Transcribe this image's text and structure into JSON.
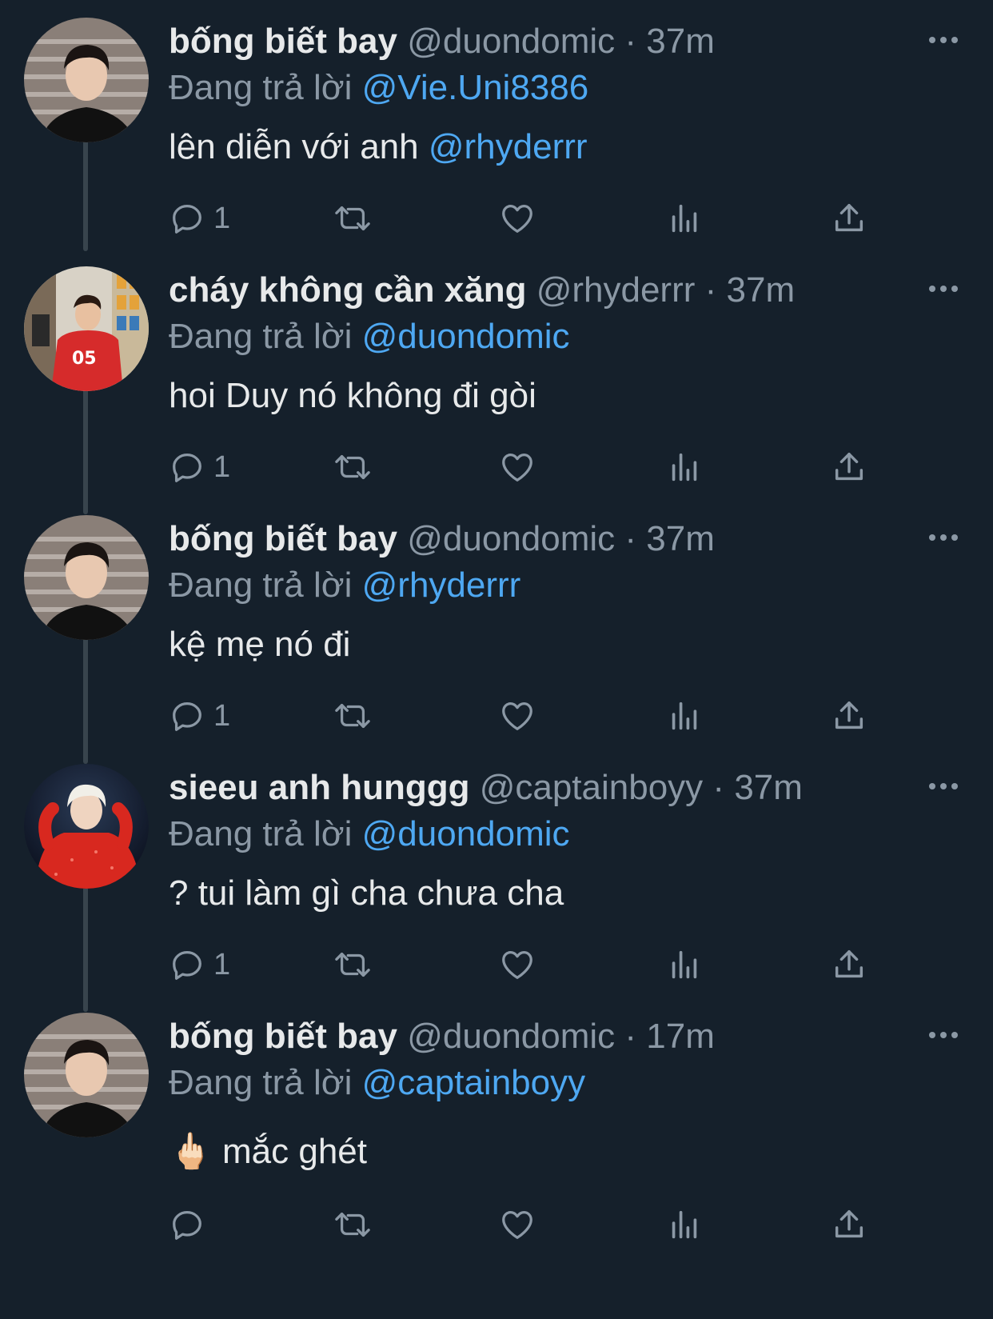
{
  "thread": {
    "reply_prefix": "Đang trả lời",
    "more_icon": "more-horizontal-icon",
    "colors": {
      "background": "#15202b",
      "name": "#e7e9ea",
      "muted": "#8b98a5",
      "mention": "#4ea8f2",
      "thread_line": "#38444d"
    },
    "tweets": [
      {
        "name": "bống biết bay",
        "handle": "@duondomic",
        "separator": "·",
        "time": "37m",
        "reply_to": "@Vie.Uni8386",
        "text": "lên diễn với anh ",
        "text_mention": "@rhyderrr",
        "reply_count": "1",
        "avatar": "avatar-duondomic"
      },
      {
        "name": "cháy không cần xăng",
        "handle": "@rhyderrr",
        "separator": "·",
        "time": "37m",
        "reply_to": "@duondomic",
        "text": "hoi Duy nó không đi gòi",
        "text_mention": "",
        "reply_count": "1",
        "avatar": "avatar-rhyderrr"
      },
      {
        "name": "bống biết bay",
        "handle": "@duondomic",
        "separator": "·",
        "time": "37m",
        "reply_to": "@rhyderrr",
        "text": "kệ mẹ nó đi",
        "text_mention": "",
        "reply_count": "1",
        "avatar": "avatar-duondomic"
      },
      {
        "name": "sieeu anh hunggg",
        "handle": "@captainboyy",
        "separator": "·",
        "time": "37m",
        "reply_to": "@duondomic",
        "text": "? tui làm gì cha chưa cha",
        "text_mention": "",
        "reply_count": "1",
        "avatar": "avatar-captainboyy"
      },
      {
        "name": "bống biết bay",
        "handle": "@duondomic",
        "separator": "·",
        "time": "17m",
        "reply_to": "@captainboyy",
        "text": "🖕🏻 mắc ghét",
        "text_mention": "",
        "reply_count": "",
        "avatar": "avatar-duondomic"
      }
    ],
    "action_icons": [
      "reply-icon",
      "retweet-icon",
      "like-icon",
      "views-icon",
      "share-icon"
    ]
  }
}
